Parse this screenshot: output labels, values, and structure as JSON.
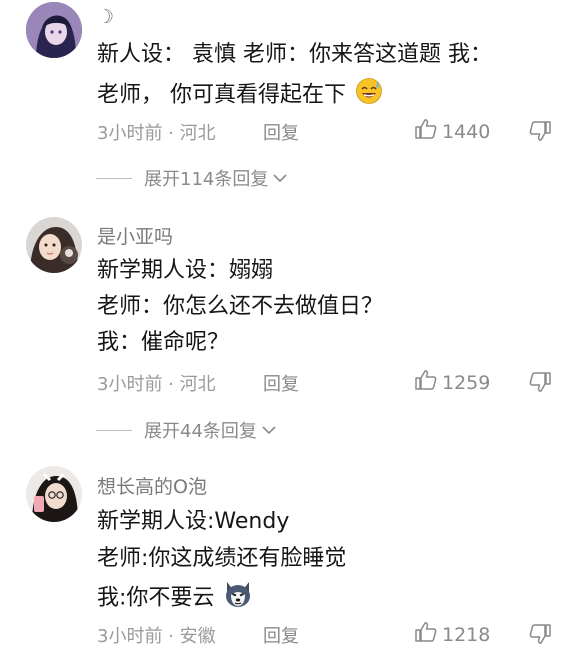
{
  "comments": [
    {
      "username": "☽",
      "lines": [
        "新人设： 袁慎 老师：你来答这道题 我：",
        "老师， 你可真看得起在下"
      ],
      "emoji": "laughing-sweat-emoji",
      "time": "3小时前 · 河北",
      "reply_label": "回复",
      "likes": "1440",
      "expand_label": "展开114条回复"
    },
    {
      "username": "是小亚吗",
      "lines": [
        "新学期人设：嫋嫋",
        "老师：你怎么还不去做值日？",
        "我：催命呢？"
      ],
      "time": "3小时前 · 河北",
      "reply_label": "回复",
      "likes": "1259",
      "expand_label": "展开44条回复"
    },
    {
      "username": "想长高的O泡",
      "lines": [
        "新学期人设:Wendy",
        "老师:你这成绩还有脸睡觉",
        "我:你不要云"
      ],
      "emoji": "husky-dog-emoji",
      "time": "3小时前 · 安徽",
      "reply_label": "回复",
      "likes": "1218"
    }
  ],
  "colors": {
    "text": "#161616",
    "meta": "#9a9a9a",
    "username": "#7a7a7a"
  }
}
